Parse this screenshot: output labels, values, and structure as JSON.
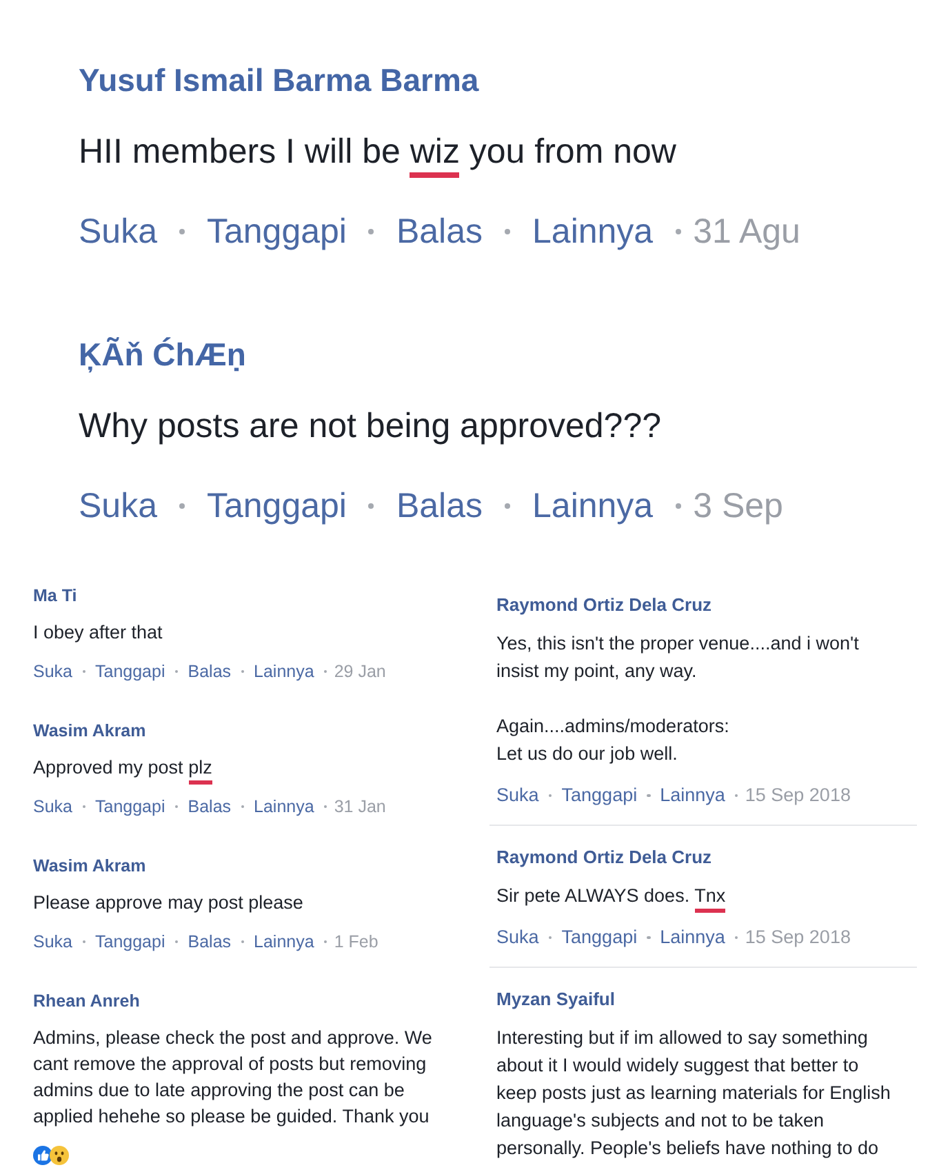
{
  "top_comments": [
    {
      "author": "Yusuf Ismail Barma Barma",
      "text": [
        {
          "text": "HII members I will be ",
          "underlined": false
        },
        {
          "text": "wiz",
          "underlined": true
        },
        {
          "text": " you from now",
          "underlined": false
        }
      ],
      "actions": [
        "Suka",
        "Tanggapi",
        "Balas",
        "Lainnya"
      ],
      "time": "31 Agu"
    },
    {
      "author": "ĶÃň ĆhÆṇ",
      "text": [
        {
          "text": "Why posts are not being approved???",
          "underlined": false
        }
      ],
      "actions": [
        "Suka",
        "Tanggapi",
        "Balas",
        "Lainnya"
      ],
      "time": "3 Sep"
    }
  ],
  "left_comments": [
    {
      "author": "Ma Ti",
      "text": [
        {
          "text": "I obey after that",
          "underlined": false
        }
      ],
      "actions": [
        "Suka",
        "Tanggapi",
        "Balas",
        "Lainnya"
      ],
      "time": "29 Jan"
    },
    {
      "author": "Wasim Akram",
      "text": [
        {
          "text": "Approved my post ",
          "underlined": false
        },
        {
          "text": "plz",
          "underlined": true
        }
      ],
      "actions": [
        "Suka",
        "Tanggapi",
        "Balas",
        "Lainnya"
      ],
      "time": "31 Jan"
    },
    {
      "author": "Wasim Akram",
      "text": [
        {
          "text": "Please approve may post please",
          "underlined": false
        }
      ],
      "actions": [
        "Suka",
        "Tanggapi",
        "Balas",
        "Lainnya"
      ],
      "time": "1 Feb"
    },
    {
      "author": "Rhean Anreh",
      "text": [
        {
          "text": "Admins, please check the post and approve. We\ncant remove the approval of posts but removing\nadmins due to late approving the post can be\napplied hehehe so please be guided. Thank you",
          "underlined": false
        }
      ],
      "reactions": [
        {
          "kind": "like"
        },
        {
          "kind": "wow"
        }
      ]
    }
  ],
  "right_comments": [
    {
      "author": "Raymond Ortiz Dela Cruz",
      "text": [
        {
          "text": "Yes, this isn't the proper venue....and i won't\ninsist my point, any way.\n\nAgain....admins/moderators:\nLet us do our job well.",
          "underlined": false
        }
      ],
      "actions": [
        "Suka",
        "Tanggapi",
        "Lainnya"
      ],
      "time": "15 Sep 2018"
    },
    {
      "author": "Raymond Ortiz Dela Cruz",
      "text": [
        {
          "text": "Sir pete ALWAYS does. ",
          "underlined": false
        },
        {
          "text": "Tnx",
          "underlined": true
        }
      ],
      "actions": [
        "Suka",
        "Tanggapi",
        "Lainnya"
      ],
      "time": "15 Sep 2018"
    },
    {
      "author": "Myzan Syaiful",
      "text": [
        {
          "text": "Interesting but if im allowed to say something\nabout it I would widely suggest that better to\nkeep posts just as learning materials for English\nlanguage's subjects and not to be taken\npersonally. People's beliefs have nothing to do",
          "underlined": false
        }
      ]
    }
  ]
}
